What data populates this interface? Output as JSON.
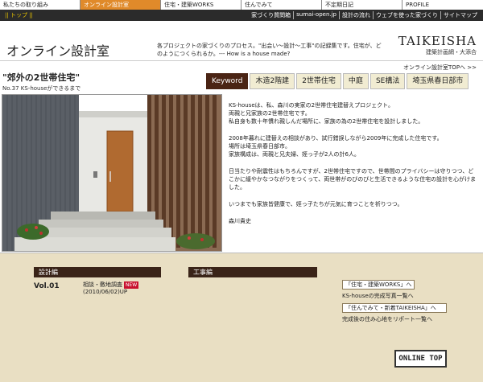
{
  "topnav": [
    {
      "label": "私たちの取り組み",
      "active": false
    },
    {
      "label": "オンライン設計室",
      "active": true
    },
    {
      "label": "住宅・建築WORKS",
      "active": false
    },
    {
      "label": "住んでみて",
      "active": false
    },
    {
      "label": "不定期日記",
      "active": false
    },
    {
      "label": "PROFILE",
      "active": false
    }
  ],
  "subbar": {
    "home": "|| トップ ||",
    "links": [
      "家づくり質問箱",
      "sumai-open.jp",
      "設計の流れ",
      "ウェブを使った家づくり",
      "サイトマップ"
    ]
  },
  "header": {
    "title": "オンライン設計室",
    "desc": "各プロジェクトの家づくりのプロセス。\"出会い〜設計〜工事\"の記録集です。住宅が、どのようにつくられるか。--- How is a house made?",
    "logo_main": "TAIKEISHA",
    "logo_sub": "建築計画網・大添合"
  },
  "toplink": "オンライン設計室TOPへ >>",
  "page": {
    "title": "\"郊外の2世帯住宅\"",
    "subtitle": "No.37 KS-houseができるまで"
  },
  "keywords": {
    "label": "Keyword",
    "tags": [
      "木造2階建",
      "2世帯住宅",
      "中庭",
      "SE構法",
      "埼玉県春日部市"
    ]
  },
  "body_paragraphs": [
    "KS-houseは、私、森川の実家の2世帯住宅建替えプロジェクト。\n両親と兄家族の2世帯住宅です。\n私自身も数十年慣れ親しんだ場所に、家族の為の2世帯住宅を設計しました。",
    "2008年暮れに建替えの相談があり、試行錯誤しながら2009年に完成した住宅です。\n場所は埼玉県春日部市。\n家族構成は、両親と兄夫婦、姪っ子が2人の計6人。",
    "日当たりや耐震性はもちろんですが、2世帯住宅ですので、世帯間のプライバシーは守りつつ、どこかに緩やかなつながりをつくって、両世帯がのびのびと生活できるような住宅の設計を心がけました。",
    "いつまでも家族皆健康で、姪っ子たちが元気に育つことを祈りつつ。",
    "森川貴史"
  ],
  "lower": {
    "design_heading": "設計編",
    "construction_heading": "工事編",
    "vol_label": "Vol.01",
    "entry_title": "相談・敷地調査",
    "new_badge": "NEW",
    "entry_date": "(2010/06/02)UP",
    "works_btn": "「住宅・建築WORKS」へ",
    "works_note": "KS-houseの完成写真一覧へ",
    "sumi_btn": "「住んでみて・新着TAIKEISHA」へ",
    "sumi_note": "完成後の住み心地をリポート一覧へ",
    "online_top": "ONLINE TOP"
  }
}
